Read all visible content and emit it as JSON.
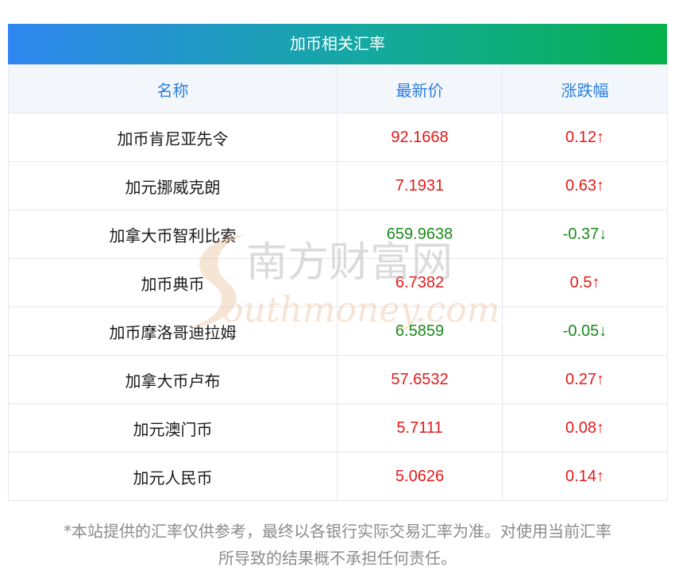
{
  "title": "加币相关汇率",
  "columns": [
    "名称",
    "最新价",
    "涨跌幅"
  ],
  "rows": [
    {
      "name": "加币肯尼亚先令",
      "price": "92.1668",
      "change": "0.12↑",
      "trend": "up"
    },
    {
      "name": "加元挪威克朗",
      "price": "7.1931",
      "change": "0.63↑",
      "trend": "up"
    },
    {
      "name": "加拿大币智利比索",
      "price": "659.9638",
      "change": "-0.37↓",
      "trend": "down"
    },
    {
      "name": "加币典币",
      "price": "6.7382",
      "change": "0.5↑",
      "trend": "up"
    },
    {
      "name": "加币摩洛哥迪拉姆",
      "price": "6.5859",
      "change": "-0.05↓",
      "trend": "down"
    },
    {
      "name": "加拿大币卢布",
      "price": "57.6532",
      "change": "0.27↑",
      "trend": "up"
    },
    {
      "name": "加元澳门币",
      "price": "5.7111",
      "change": "0.08↑",
      "trend": "up"
    },
    {
      "name": "加元人民币",
      "price": "5.0626",
      "change": "0.14↑",
      "trend": "up"
    }
  ],
  "disclaimer_line1": "*本站提供的汇率仅供参考，最终以各银行实际交易汇率为准。对使用当前汇率",
  "disclaimer_line2": "所导致的结果概不承担任何责任。",
  "watermark": {
    "cn": "南方财富网",
    "en": "outhmoney.com"
  },
  "colors": {
    "up": "#e41a1a",
    "down": "#1a8a1a",
    "header_text": "#2b7fe0",
    "title_gradient_start": "#2f86f0",
    "title_gradient_end": "#06b04a"
  }
}
